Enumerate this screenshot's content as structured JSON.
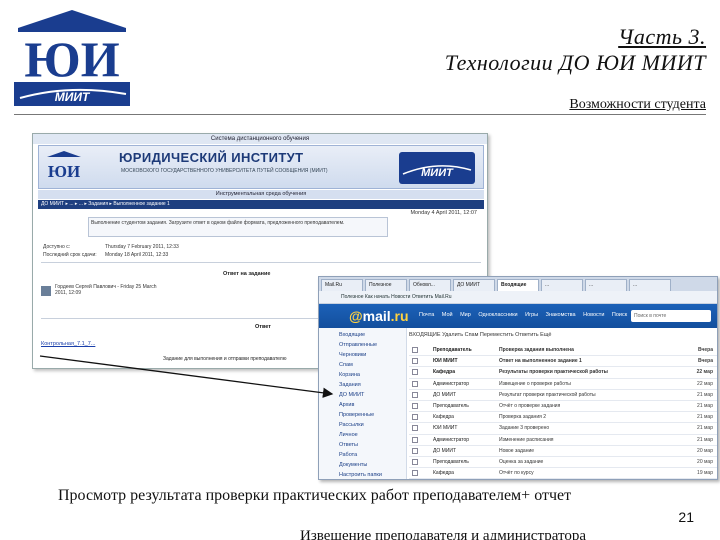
{
  "header": {
    "part_title": "Часть 3.",
    "main_title": "Технологии ДО ЮИ МИИТ",
    "section_title": "Возможности студента",
    "logo_text": "ЮИ",
    "logo_miit_text": "МИИТ"
  },
  "lms_screenshot": {
    "top_bar": "Система дистанционного обучения",
    "institute_name": "ЮРИДИЧЕСКИЙ ИНСТИТУТ",
    "institute_subtitle": "МОСКОВСКОГО ГОСУДАРСТВЕННОГО УНИВЕРСИТЕТА ПУТЕЙ СООБЩЕНИЯ (МИИТ)",
    "miit_logo_text": "МИИТ",
    "env_bar": "Инструментальная среда обучения",
    "nav_text": "ДО МИИТ ▸ ... ▸ ... ▸ Задания ▸ Выполненное задание 1",
    "date_right": "Monday 4 April 2011, 12:07",
    "message_text": "Выполнение студентом задания. Загрузите ответ в одном файле формата, предложенного преподавателем.",
    "available_label": "Доступно с:",
    "available_value": "Thursday 7 February 2011, 12:33",
    "deadline_label": "Последний срок сдачи:",
    "deadline_value": "Monday 18 April 2011, 12:33",
    "answer_heading": "Ответ на задание",
    "student_info": "Гордеев Сергей Павлович - Friday 25 March 2011, 12:09",
    "answer_label": "Ответ",
    "file_link": "Контрольная_7.1_7...",
    "footer_note": "Задание для выполнения и отправки преподавателю"
  },
  "mail_screenshot": {
    "tabs": [
      "Mail.Ru",
      "Полезное",
      "Обновл...",
      "ДО МИИТ",
      "Входящие",
      "...",
      "...",
      "..."
    ],
    "bookmarks": "Полезное   Как начать   Новости   Ответить   Mail.Ru",
    "logo_at": "@",
    "logo_mail": "mail",
    "logo_ru": ".ru",
    "header_links": "Почта  Мой Мир  Одноклассники  Игры  Знакомства  Новости  Поиск  Все проекты",
    "search_placeholder": "Поиск в почте",
    "folders": [
      "Входящие",
      "Отправленные",
      "Черновики",
      "Спам",
      "Корзина",
      "Задания",
      "ДО МИИТ",
      "Архив",
      "Проверенные",
      "Рассылки",
      "Личное",
      "Ответы",
      "Работа",
      "Документы",
      "Настроить папки"
    ],
    "toolbar": "ВХОДЯЩИЕ   Удалить   Спам   Переместить   Ответить   Ещё",
    "messages": [
      {
        "from": "Преподаватель",
        "subject": "Проверка задания выполнена",
        "date": "Вчера"
      },
      {
        "from": "ЮИ МИИТ",
        "subject": "Ответ на выполненное задание 1",
        "date": "Вчера"
      },
      {
        "from": "Кафедра",
        "subject": "Результаты проверки практической работы",
        "date": "22 мар"
      },
      {
        "from": "Администратор",
        "subject": "Извещение о проверке работы",
        "date": "22 мар"
      },
      {
        "from": "ДО МИИТ",
        "subject": "Результат проверки практической работы",
        "date": "21 мар"
      },
      {
        "from": "Преподаватель",
        "subject": "Отчёт о проверке задания",
        "date": "21 мар"
      },
      {
        "from": "Кафедра",
        "subject": "Проверка задания 2",
        "date": "21 мар"
      },
      {
        "from": "ЮИ МИИТ",
        "subject": "Задание 3 проверено",
        "date": "21 мар"
      },
      {
        "from": "Администратор",
        "subject": "Изменение расписания",
        "date": "21 мар"
      },
      {
        "from": "ДО МИИТ",
        "subject": "Новое задание",
        "date": "20 мар"
      },
      {
        "from": "Преподаватель",
        "subject": "Оценка за задание",
        "date": "20 мар"
      },
      {
        "from": "Кафедра",
        "subject": "Отчёт по курсу",
        "date": "19 мар"
      }
    ]
  },
  "caption": "Просмотр результата проверки практических работ преподавателем+ отчет",
  "page_number": "21",
  "footer_text": "Извещение преподавателя и администратора"
}
